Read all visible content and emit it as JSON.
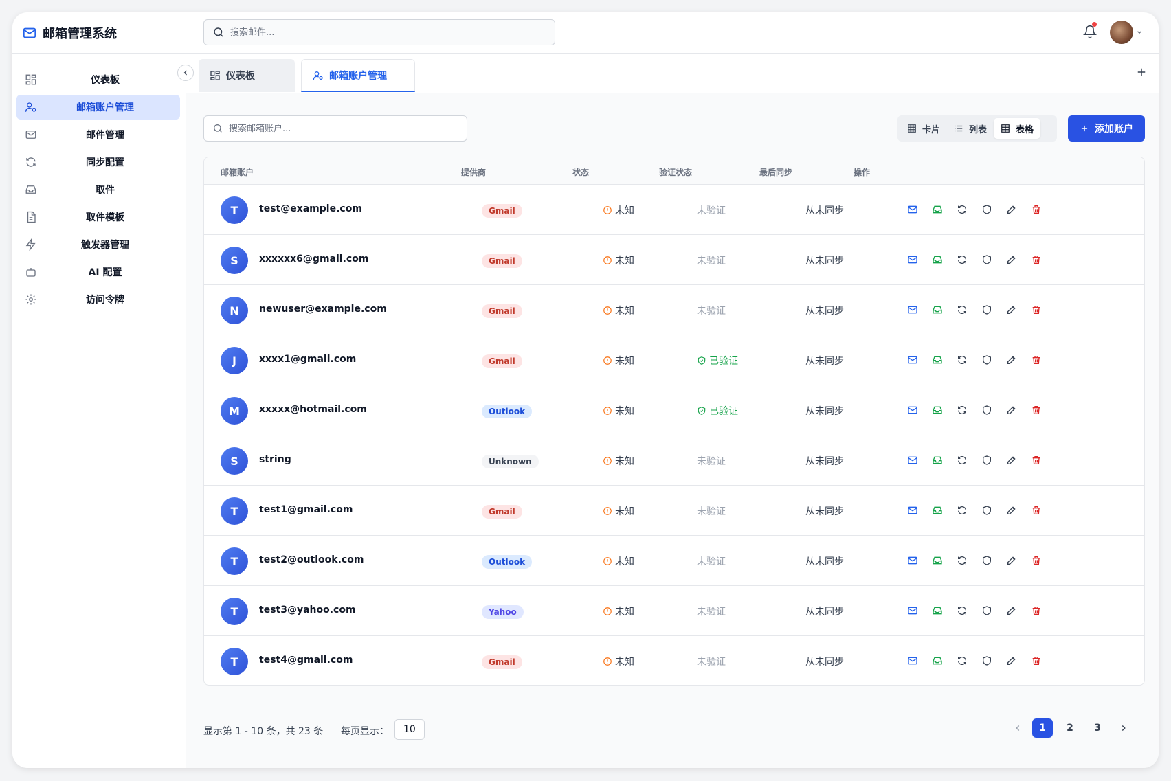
{
  "app": {
    "title": "邮箱管理系统"
  },
  "global_search": {
    "placeholder": "搜索邮件..."
  },
  "sidebar": {
    "items": [
      {
        "label": "仪表板",
        "icon": "dashboard-icon"
      },
      {
        "label": "邮箱账户管理",
        "icon": "user-settings-icon",
        "active": true
      },
      {
        "label": "邮件管理",
        "icon": "mail-icon"
      },
      {
        "label": "同步配置",
        "icon": "refresh-icon"
      },
      {
        "label": "取件",
        "icon": "inbox-icon"
      },
      {
        "label": "取件模板",
        "icon": "file-icon"
      },
      {
        "label": "触发器管理",
        "icon": "zap-icon"
      },
      {
        "label": "AI 配置",
        "icon": "bot-icon"
      },
      {
        "label": "访问令牌",
        "icon": "gear-icon"
      }
    ]
  },
  "tabs": [
    {
      "label": "仪表板",
      "active": false
    },
    {
      "label": "邮箱账户管理",
      "active": true
    }
  ],
  "account_search": {
    "placeholder": "搜索邮箱账户..."
  },
  "view_toggle": {
    "card": "卡片",
    "list": "列表",
    "table": "表格",
    "active": "table"
  },
  "add_button": {
    "label": "添加账户"
  },
  "table": {
    "headers": {
      "account": "邮箱账户",
      "provider": "提供商",
      "status": "状态",
      "verify": "验证状态",
      "last_sync": "最后同步",
      "actions": "操作"
    },
    "rows": [
      {
        "initial": "T",
        "email": "test@example.com",
        "provider": "Gmail",
        "status": "未知",
        "verify": "未验证",
        "verified": false,
        "last_sync": "从未同步"
      },
      {
        "initial": "S",
        "email": "xxxxxx6@gmail.com",
        "provider": "Gmail",
        "status": "未知",
        "verify": "未验证",
        "verified": false,
        "last_sync": "从未同步"
      },
      {
        "initial": "N",
        "email": "newuser@example.com",
        "provider": "Gmail",
        "status": "未知",
        "verify": "未验证",
        "verified": false,
        "last_sync": "从未同步"
      },
      {
        "initial": "J",
        "email": "xxxx1@gmail.com",
        "provider": "Gmail",
        "status": "未知",
        "verify": "已验证",
        "verified": true,
        "last_sync": "从未同步"
      },
      {
        "initial": "M",
        "email": "xxxxx@hotmail.com",
        "provider": "Outlook",
        "status": "未知",
        "verify": "已验证",
        "verified": true,
        "last_sync": "从未同步"
      },
      {
        "initial": "S",
        "email": "string",
        "provider": "Unknown",
        "status": "未知",
        "verify": "未验证",
        "verified": false,
        "last_sync": "从未同步"
      },
      {
        "initial": "T",
        "email": "test1@gmail.com",
        "provider": "Gmail",
        "status": "未知",
        "verify": "未验证",
        "verified": false,
        "last_sync": "从未同步"
      },
      {
        "initial": "T",
        "email": "test2@outlook.com",
        "provider": "Outlook",
        "status": "未知",
        "verify": "未验证",
        "verified": false,
        "last_sync": "从未同步"
      },
      {
        "initial": "T",
        "email": "test3@yahoo.com",
        "provider": "Yahoo",
        "status": "未知",
        "verify": "未验证",
        "verified": false,
        "last_sync": "从未同步"
      },
      {
        "initial": "T",
        "email": "test4@gmail.com",
        "provider": "Gmail",
        "status": "未知",
        "verify": "未验证",
        "verified": false,
        "last_sync": "从未同步"
      }
    ]
  },
  "footer": {
    "info": "显示第 1 - 10 条，共 23 条",
    "per_page_label": "每页显示：",
    "per_page_value": "10",
    "pages": [
      "1",
      "2",
      "3"
    ],
    "current_page": "1"
  },
  "colors": {
    "accent": "#2952e3",
    "gmail": "#c0392b",
    "outlook": "#1d4ed8",
    "verified": "#16a34a",
    "unknown_status": "#f97316",
    "delete": "#dc2626"
  }
}
